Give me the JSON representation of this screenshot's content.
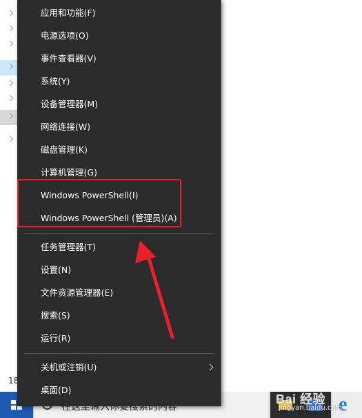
{
  "background_explorer": {
    "side_number": "18"
  },
  "context_menu": {
    "group1": [
      {
        "id": "apps-features",
        "label": "应用和功能(F)"
      },
      {
        "id": "power-options",
        "label": "电源选项(O)"
      },
      {
        "id": "event-viewer",
        "label": "事件查看器(V)"
      },
      {
        "id": "system",
        "label": "系统(Y)"
      },
      {
        "id": "device-manager",
        "label": "设备管理器(M)"
      },
      {
        "id": "network-connections",
        "label": "网络连接(W)"
      },
      {
        "id": "disk-management",
        "label": "磁盘管理(K)"
      },
      {
        "id": "computer-management",
        "label": "计算机管理(G)"
      },
      {
        "id": "powershell",
        "label": "Windows PowerShell(I)"
      },
      {
        "id": "powershell-admin",
        "label": "Windows PowerShell (管理员)(A)"
      }
    ],
    "group2": [
      {
        "id": "task-manager",
        "label": "任务管理器(T)"
      },
      {
        "id": "settings",
        "label": "设置(N)"
      },
      {
        "id": "file-explorer",
        "label": "文件资源管理器(E)"
      },
      {
        "id": "search",
        "label": "搜索(S)"
      },
      {
        "id": "run",
        "label": "运行(R)"
      }
    ],
    "group3": [
      {
        "id": "shutdown-signout",
        "label": "关机或注销(U)",
        "has_submenu": true
      },
      {
        "id": "desktop",
        "label": "桌面(D)"
      }
    ]
  },
  "taskbar": {
    "search_text": "在这里输入你要搜索的内容",
    "icons": [
      "windows-start-icon",
      "search-icon",
      "folder-icon",
      "store-icon",
      "edge-icon"
    ]
  },
  "annotation": {
    "box_color": "#e8202a",
    "arrow_color": "#e8202a"
  },
  "watermark": {
    "main": "Bai 经验",
    "sub": "jingyan.baidu.com"
  }
}
